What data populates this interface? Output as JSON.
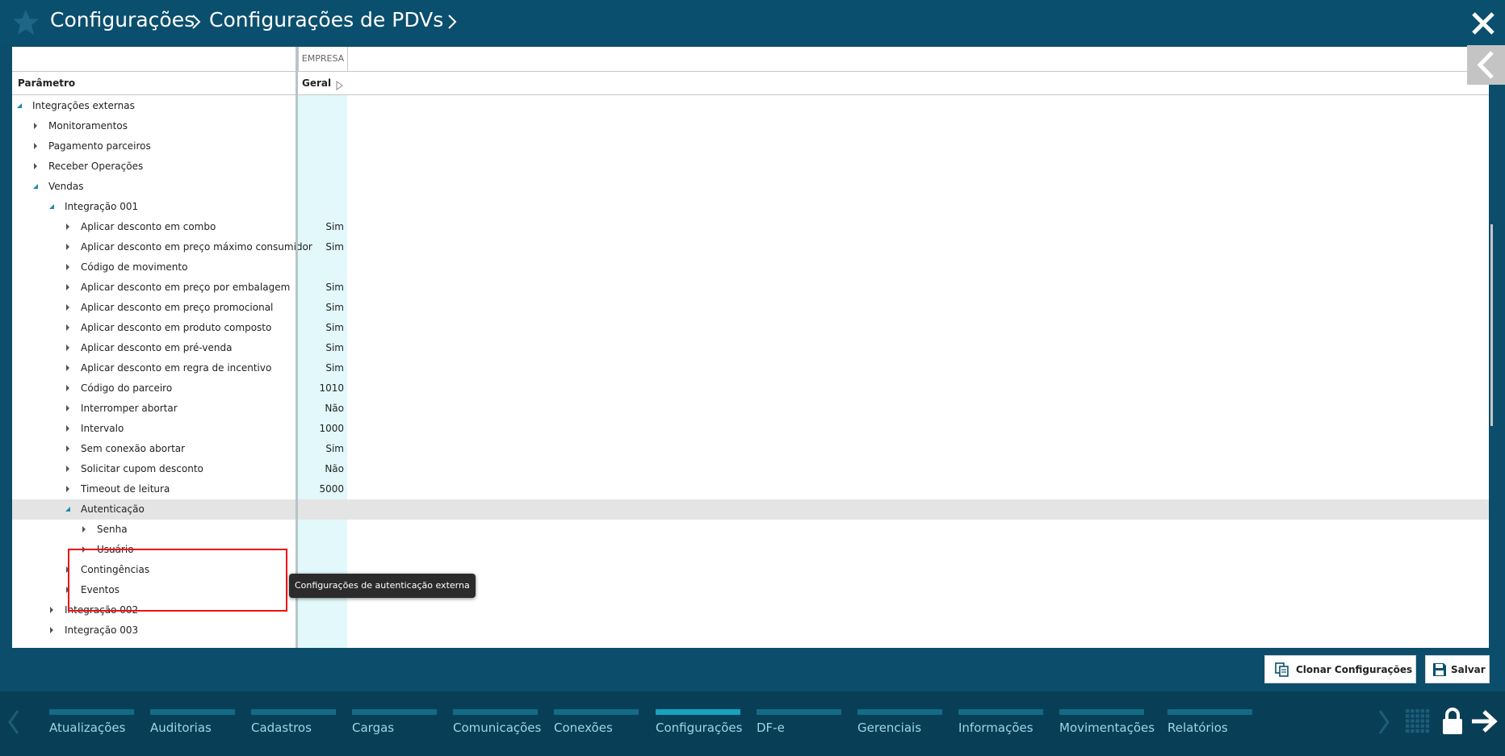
{
  "header": {
    "breadcrumb": [
      "Configurações",
      "Configurações de PDVs"
    ]
  },
  "table": {
    "column_group": "EMPRESA",
    "param_header": "Parâmetro",
    "value_header": "Geral",
    "rows": [
      {
        "label": "Integrações externas",
        "value": "",
        "expanded": true
      },
      {
        "label": "Monitoramentos",
        "value": "",
        "expanded": false
      },
      {
        "label": "Pagamento parceiros",
        "value": "",
        "expanded": false
      },
      {
        "label": "Receber Operações",
        "value": "",
        "expanded": false
      },
      {
        "label": "Vendas",
        "value": "",
        "expanded": true
      },
      {
        "label": "Integração 001",
        "value": "",
        "expanded": true
      },
      {
        "label": "Aplicar desconto em combo",
        "value": "Sim",
        "expanded": false
      },
      {
        "label": "Aplicar desconto em preço máximo consumidor",
        "value": "Sim",
        "expanded": false
      },
      {
        "label": "Código de movimento",
        "value": "",
        "expanded": false
      },
      {
        "label": "Aplicar desconto em preço por embalagem",
        "value": "Sim",
        "expanded": false
      },
      {
        "label": "Aplicar desconto em preço promocional",
        "value": "Sim",
        "expanded": false
      },
      {
        "label": "Aplicar desconto em produto composto",
        "value": "Sim",
        "expanded": false
      },
      {
        "label": "Aplicar desconto em pré-venda",
        "value": "Sim",
        "expanded": false
      },
      {
        "label": "Aplicar desconto em regra de incentivo",
        "value": "Sim",
        "expanded": false
      },
      {
        "label": "Código do parceiro",
        "value": "1010",
        "expanded": false
      },
      {
        "label": "Interromper abortar",
        "value": "Não",
        "expanded": false
      },
      {
        "label": "Intervalo",
        "value": "1000",
        "expanded": false
      },
      {
        "label": "Sem conexão abortar",
        "value": "Sim",
        "expanded": false
      },
      {
        "label": "Solicitar cupom desconto",
        "value": "Não",
        "expanded": false
      },
      {
        "label": "Timeout de leitura",
        "value": "5000",
        "expanded": false
      },
      {
        "label": "Autenticação",
        "value": "",
        "expanded": true,
        "selected": true
      },
      {
        "label": "Senha",
        "value": "",
        "expanded": false
      },
      {
        "label": "Usuário",
        "value": "",
        "expanded": false
      },
      {
        "label": "Contingências",
        "value": "",
        "expanded": false
      },
      {
        "label": "Eventos",
        "value": "",
        "expanded": false
      },
      {
        "label": "Integração 002",
        "value": "",
        "expanded": false
      },
      {
        "label": "Integração 003",
        "value": "",
        "expanded": false
      }
    ]
  },
  "tooltip": "Configurações de autenticação externa",
  "actions": {
    "clone_label": "Clonar Configurações",
    "save_label": "Salvar"
  },
  "bottom_nav": {
    "items": [
      {
        "label": "Atualizações",
        "active": false
      },
      {
        "label": "Auditorias",
        "active": false
      },
      {
        "label": "Cadastros",
        "active": false
      },
      {
        "label": "Cargas",
        "active": false
      },
      {
        "label": "Comunicações",
        "active": false
      },
      {
        "label": "Conexões",
        "active": false
      },
      {
        "label": "Configurações",
        "active": true
      },
      {
        "label": "DF-e",
        "active": false
      },
      {
        "label": "Gerenciais",
        "active": false
      },
      {
        "label": "Informações",
        "active": false
      },
      {
        "label": "Movimentações",
        "active": false
      },
      {
        "label": "Relatórios",
        "active": false
      }
    ]
  },
  "colors": {
    "header_bg": "#0b4f6e",
    "nav_bg": "#083f57",
    "accent": "#17a2be",
    "highlight_border": "#ee1111",
    "value_column_bg": "#e2f8fa"
  }
}
